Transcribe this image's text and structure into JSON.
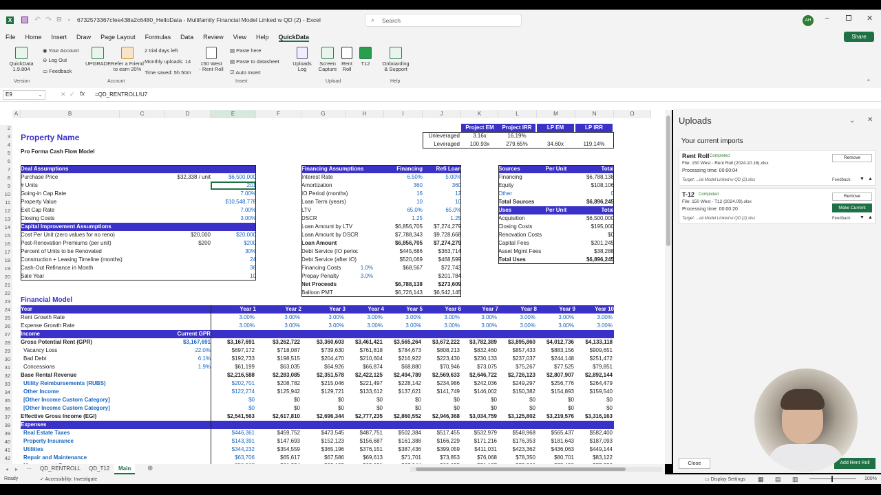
{
  "window": {
    "title": "6732573367cfee438a2c6480_HelloData - Multifamily Financial Model Linked w QD (2) - Excel",
    "search": "Search",
    "avatar": "AH",
    "share": "Share"
  },
  "tabs": [
    "File",
    "Home",
    "Insert",
    "Draw",
    "Page Layout",
    "Formulas",
    "Data",
    "Review",
    "View",
    "Help",
    "QuickData"
  ],
  "ribbon": {
    "quickdata": "QuickData",
    "qd_version": "1.9.804",
    "your_account": "Your Account",
    "log_out": "Log Out",
    "feedback": "Feedback",
    "upgrade": "UPGRADE",
    "refer": "Refer a Friend",
    "refer2": "to earn 20%",
    "trial": "2 trial days left",
    "uploads_monthly": "Monthly uploads: 14",
    "time_saved": "Time saved: 5h 50m",
    "rentroll_btn": "150 West",
    "rentroll_btn2": "- Rent Roll",
    "paste_here": "Paste here",
    "paste_datasheet": "Paste to datasheet",
    "auto_insert": "Auto Insert",
    "uploads_log": "Uploads",
    "uploads_log2": "Log",
    "screen_capture": "Screen",
    "screen_capture2": "Capture",
    "rent_roll": "Rent",
    "rent_roll2": "Roll",
    "t12": "T12",
    "onboarding": "Onboarding",
    "onboarding2": "& Support",
    "grp_version": "Version",
    "grp_account": "Account",
    "grp_insert": "Insert",
    "grp_upload": "Upload",
    "grp_help": "Help"
  },
  "formula": {
    "namebox": "E9",
    "fx": "fx",
    "content": "=QD_RENTROLL!U7"
  },
  "columns": [
    "A",
    "B",
    "C",
    "D",
    "E",
    "F",
    "G",
    "H",
    "I",
    "J",
    "K",
    "L",
    "M",
    "N",
    "O"
  ],
  "sheet": {
    "property_name": "Property Name",
    "subtitle": "Pro Forma Cash Flow Model",
    "returns_hdr": [
      "Project EM",
      "Project IRR",
      "LP EM",
      "LP IRR"
    ],
    "unlevered": [
      "Unleveraged",
      "3.16x",
      "16.19%",
      "",
      ""
    ],
    "levered": [
      "Leveraged",
      "100.93x",
      "279.65%",
      "34.60x",
      "119.14%"
    ],
    "deal_hdr": "Deal Assumptions",
    "deal": [
      [
        "Purchase Price",
        "$32,338 / unit",
        "$6,500,000"
      ],
      [
        "# Units",
        "",
        "201"
      ],
      [
        "Going-in Cap Rate",
        "",
        "7.00%"
      ],
      [
        "Property Value",
        "",
        "$10,548,778"
      ],
      [
        "Exit Cap Rate",
        "",
        "7.00%"
      ],
      [
        "Closing Costs",
        "",
        "3.00%"
      ]
    ],
    "capex_hdr": "Capital Improvement Assumptions",
    "capex": [
      [
        "Cost Per Unit (zero values for no reno)",
        "$20,000",
        "$20,000"
      ],
      [
        "Post-Renovation Premiums (per unit)",
        "$200",
        "$200"
      ],
      [
        "Percent of Units to be Renovated",
        "",
        "30%"
      ],
      [
        "Construction + Leasing Timeline (months)",
        "",
        "24"
      ],
      [
        "Cash-Out Refinance in Month",
        "",
        "36"
      ],
      [
        "Sale Year",
        "",
        "10"
      ]
    ],
    "fin_hdr": [
      "Financing Assumptions",
      "Financing",
      "Refi Loan"
    ],
    "fin": [
      [
        "Interest Rate",
        "",
        "6.50%",
        "5.00%"
      ],
      [
        "Amortization",
        "",
        "360",
        "360"
      ],
      [
        "IO Period (months)",
        "",
        "16",
        "12"
      ],
      [
        "Loan Term (years)",
        "",
        "10",
        "10"
      ],
      [
        "LTV",
        "",
        "65.0%",
        "65.0%"
      ],
      [
        "DSCR",
        "",
        "1.25",
        "1.25"
      ],
      [
        "Loan Amount by LTV",
        "",
        "$6,856,705",
        "$7,274,279"
      ],
      [
        "Loan Amount by DSCR",
        "",
        "$7,788,343",
        "$9,728,668"
      ],
      [
        "Loan Amount",
        "",
        "$6,856,705",
        "$7,274,279"
      ],
      [
        "Debt Service (IO period)",
        "",
        "$445,686",
        "$363,714"
      ],
      [
        "Debt Service (after IO)",
        "",
        "$520,069",
        "$468,599"
      ],
      [
        "Financing Costs",
        "1.0%",
        "$68,567",
        "$72,743"
      ],
      [
        "Prepay Penalty",
        "3.0%",
        "",
        "$201,784"
      ],
      [
        "Net Proceeds",
        "",
        "$6,788,138",
        "$273,609"
      ],
      [
        "Balloon PMT",
        "",
        "$6,726,143",
        "$6,542,145"
      ]
    ],
    "sources_hdr": [
      "Sources",
      "Per Unit",
      "Total"
    ],
    "sources": [
      [
        "Financing",
        "",
        "$6,788,138"
      ],
      [
        "Equity",
        "",
        "$108,106"
      ],
      [
        "Other",
        "",
        "0"
      ],
      [
        "Total Sources",
        "",
        "$6,896,245"
      ]
    ],
    "uses_hdr": [
      "Uses",
      "Per Unit",
      "Total"
    ],
    "uses": [
      [
        "Acquisition",
        "",
        "$6,500,000"
      ],
      [
        "Closing Costs",
        "",
        "$195,000"
      ],
      [
        "Renovation Costs",
        "",
        "$0"
      ],
      [
        "Capital Fees",
        "",
        "$201,245"
      ],
      [
        "Asset Mgmt Fees",
        "",
        "$38,288"
      ],
      [
        "Total Uses",
        "",
        "$6,896,245"
      ]
    ],
    "fm_title": "Financial Model",
    "years": [
      "Year",
      "Year 1",
      "Year 2",
      "Year 3",
      "Year 4",
      "Year 5",
      "Year 6",
      "Year 7",
      "Year 8",
      "Year 9",
      "Year 10"
    ],
    "fm_rows": [
      {
        "label": "Rent Growth Rate",
        "gpr": "",
        "vals": [
          "3.00%",
          "3.00%",
          "3.00%",
          "3.00%",
          "3.00%",
          "3.00%",
          "3.00%",
          "3.00%",
          "3.00%",
          "3.00%"
        ],
        "style": "blue"
      },
      {
        "label": "Expense Growth Rate",
        "gpr": "",
        "vals": [
          "3.00%",
          "3.00%",
          "3.00%",
          "3.00%",
          "3.00%",
          "3.00%",
          "3.00%",
          "3.00%",
          "3.00%",
          "3.00%"
        ],
        "style": "blue"
      },
      {
        "label": "Income",
        "gpr": "Current GPR",
        "vals": [
          "",
          "",
          "",
          "",
          "",
          "",
          "",
          "",
          "",
          ""
        ],
        "style": "hdr"
      },
      {
        "label": "Gross Potential Rent (GPR)",
        "gpr": "$3,167,691",
        "vals": [
          "$3,167,691",
          "$3,262,722",
          "$3,360,603",
          "$3,461,421",
          "$3,565,264",
          "$3,672,222",
          "$3,782,389",
          "$3,895,860",
          "$4,012,736",
          "$4,133,118"
        ],
        "style": "bold"
      },
      {
        "label": "Vacancy Loss",
        "gpr": "22.0%",
        "vals": [
          "$697,172",
          "$718,087",
          "$739,630",
          "$761,818",
          "$784,673",
          "$808,213",
          "$832,460",
          "$857,433",
          "$883,156",
          "$909,651"
        ],
        "style": "ind"
      },
      {
        "label": "Bad Debt",
        "gpr": "6.1%",
        "vals": [
          "$192,733",
          "$198,515",
          "$204,470",
          "$210,604",
          "$216,922",
          "$223,430",
          "$230,133",
          "$237,037",
          "$244,148",
          "$251,472"
        ],
        "style": "ind"
      },
      {
        "label": "Concessions",
        "gpr": "1.9%",
        "vals": [
          "$61,199",
          "$63,035",
          "$64,926",
          "$66,874",
          "$68,880",
          "$70,946",
          "$73,075",
          "$75,267",
          "$77,525",
          "$79,851"
        ],
        "style": "ind"
      },
      {
        "label": "Base Rental Revenue",
        "gpr": "",
        "vals": [
          "$2,216,588",
          "$2,283,085",
          "$2,351,578",
          "$2,422,125",
          "$2,494,789",
          "$2,569,633",
          "$2,646,722",
          "$2,726,123",
          "$2,807,907",
          "$2,892,144"
        ],
        "style": "bold"
      },
      {
        "label": "Utility Reimbursements (RUBS)",
        "gpr": "",
        "vals": [
          "$202,701",
          "$208,782",
          "$215,046",
          "$221,497",
          "$228,142",
          "$234,986",
          "$242,036",
          "$249,297",
          "$256,776",
          "$264,479"
        ],
        "style": "blueind"
      },
      {
        "label": "Other Income",
        "gpr": "",
        "vals": [
          "$122,274",
          "$125,942",
          "$129,721",
          "$133,612",
          "$137,621",
          "$141,749",
          "$146,002",
          "$150,382",
          "$154,893",
          "$159,540"
        ],
        "style": "blueind"
      },
      {
        "label": "[Other Income Custom Category]",
        "gpr": "",
        "vals": [
          "$0",
          "$0",
          "$0",
          "$0",
          "$0",
          "$0",
          "$0",
          "$0",
          "$0",
          "$0"
        ],
        "style": "blueind"
      },
      {
        "label": "[Other Income Custom Category]",
        "gpr": "",
        "vals": [
          "$0",
          "$0",
          "$0",
          "$0",
          "$0",
          "$0",
          "$0",
          "$0",
          "$0",
          "$0"
        ],
        "style": "blueind"
      },
      {
        "label": "Effective Gross Income (EGI)",
        "gpr": "",
        "vals": [
          "$2,541,563",
          "$2,617,810",
          "$2,696,344",
          "$2,777,235",
          "$2,860,552",
          "$2,946,368",
          "$3,034,759",
          "$3,125,802",
          "$3,219,576",
          "$3,316,163"
        ],
        "style": "bold"
      },
      {
        "label": "Expenses",
        "gpr": "",
        "vals": [
          "",
          "",
          "",
          "",
          "",
          "",
          "",
          "",
          "",
          ""
        ],
        "style": "hdr"
      },
      {
        "label": "Real Estate Taxes",
        "gpr": "",
        "vals": [
          "$446,361",
          "$459,752",
          "$473,545",
          "$487,751",
          "$502,384",
          "$517,455",
          "$532,979",
          "$548,968",
          "$565,437",
          "$582,400"
        ],
        "style": "blueind"
      },
      {
        "label": "Property Insurance",
        "gpr": "",
        "vals": [
          "$143,391",
          "$147,693",
          "$152,123",
          "$156,687",
          "$161,388",
          "$166,229",
          "$171,216",
          "$176,353",
          "$181,643",
          "$187,093"
        ],
        "style": "blueind"
      },
      {
        "label": "Utilities",
        "gpr": "",
        "vals": [
          "$344,232",
          "$354,559",
          "$365,196",
          "$376,151",
          "$387,436",
          "$399,059",
          "$411,031",
          "$423,362",
          "$436,063",
          "$449,144"
        ],
        "style": "blueind"
      },
      {
        "label": "Repair and Maintenance",
        "gpr": "",
        "vals": [
          "$63,706",
          "$65,617",
          "$67,586",
          "$69,613",
          "$71,701",
          "$73,853",
          "$76,068",
          "$78,350",
          "$80,701",
          "$83,122"
        ],
        "style": "blueind"
      },
      {
        "label": "Management Fees",
        "gpr": "",
        "vals": [
          "$59,567",
          "$61,354",
          "$63,195",
          "$65,091",
          "$67,044",
          "$69,055",
          "$71,127",
          "$73,260",
          "$75,458",
          "$77,722"
        ],
        "style": "blueind"
      }
    ]
  },
  "sheet_tabs": [
    "QD_RENTROLL",
    "QD_T12",
    "Main"
  ],
  "status": {
    "ready": "Ready",
    "access": "Accessibility: Investigate",
    "display": "Display Settings",
    "zoom": "100%"
  },
  "panel": {
    "title": "Uploads",
    "subtitle": "Your current imports",
    "cards": [
      {
        "name": "Rent Roll",
        "state": "Completed",
        "file": "File: 150 West - Rent Roll (2024.10.16).xlsx",
        "time": "Processing time: 00:00:04",
        "target": "Target: ...ial Model Linked w QD (2).xlsx",
        "remove": "Remove",
        "make": ""
      },
      {
        "name": "T-12",
        "state": "Completed",
        "file": "File: 150 West - T12 (2024.09).xlsx",
        "time": "Processing time: 00:00:20",
        "target": "Target: ...ial Model Linked w QD (2).xlsx",
        "remove": "Remove",
        "make": "Make Current"
      }
    ],
    "feedback": "Feedback:",
    "close": "Close",
    "add": "Add Rent Roll"
  }
}
